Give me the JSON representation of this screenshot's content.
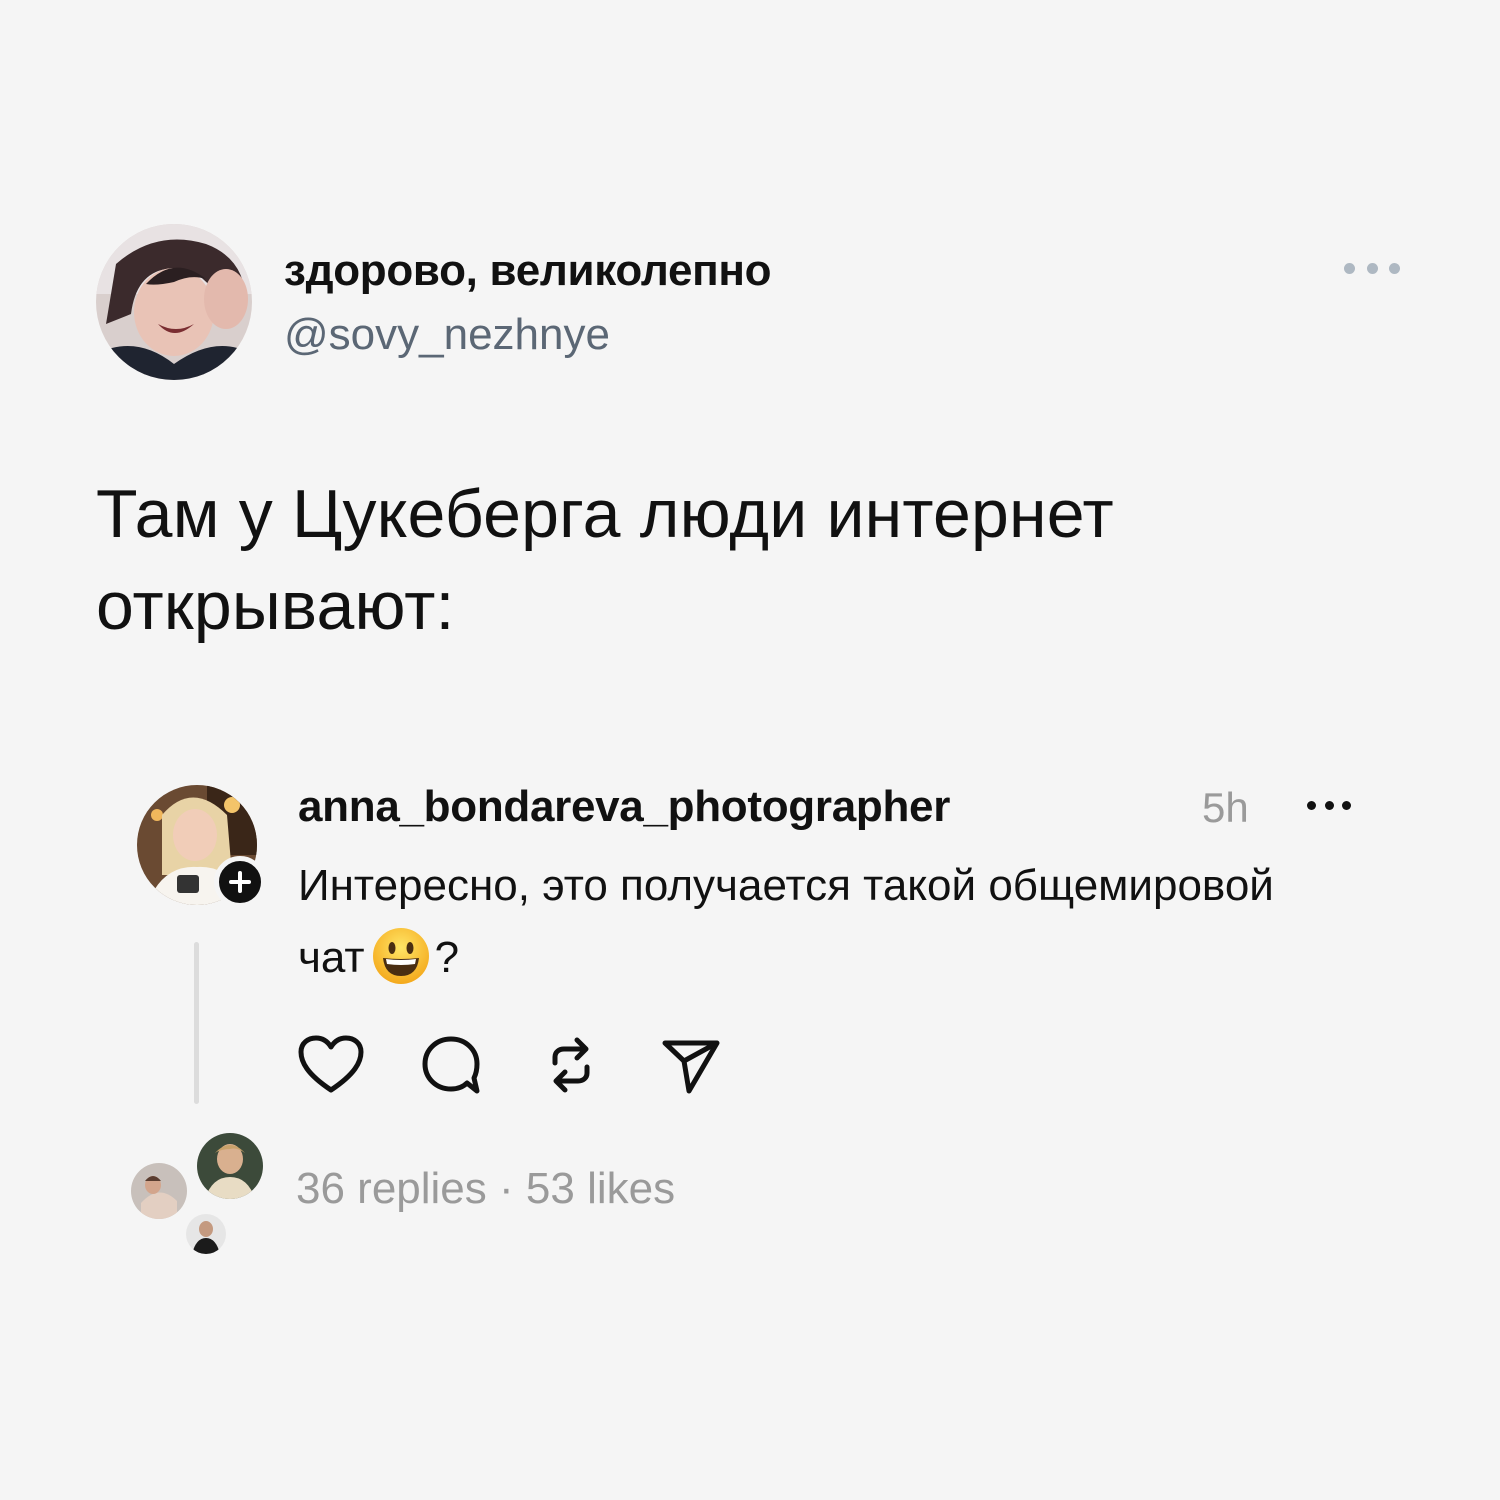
{
  "tweet": {
    "display_name": "здорово, великолепно",
    "handle": "@sovy_nezhnye",
    "text": "Там у Цукеберга люди интернет открывают:",
    "more_icon": "more-horizontal-icon"
  },
  "thread_post": {
    "username": "anna_bondareva_photographer",
    "time": "5h",
    "text": "Интересно, это получается такой общемировой чат",
    "text_suffix": "?",
    "emoji": "grinning-face-emoji",
    "replies": "36 replies",
    "separator": "·",
    "likes": "53 likes",
    "icons": [
      "heart-icon",
      "comment-icon",
      "repost-icon",
      "share-icon"
    ]
  },
  "colors": {
    "background": "#f5f5f5",
    "handle": "#5b6775",
    "muted": "#9a9a9a"
  }
}
